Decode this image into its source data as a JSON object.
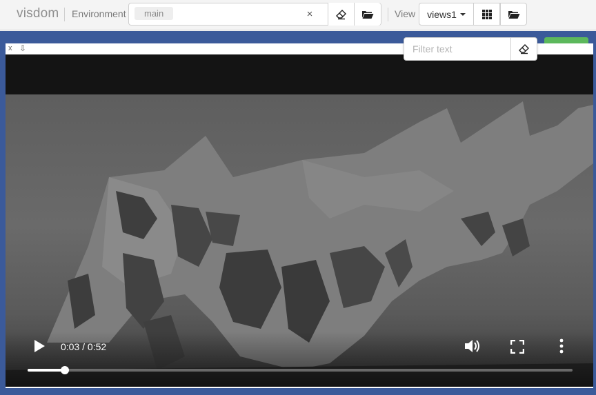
{
  "navbar": {
    "brand": "visdom",
    "environment_label": "Environment",
    "environment_selected": "main",
    "clear_symbol": "×",
    "view_label": "View",
    "views_selected": "views1"
  },
  "icons": {
    "eraser": "eraser-icon",
    "folder": "folder-open-icon",
    "grid": "grid-icon",
    "close": "close-icon"
  },
  "filter": {
    "placeholder": "Filter text"
  },
  "pane": {
    "close_symbol": "x",
    "download_symbol": "⇩"
  },
  "video": {
    "current_time": "0:03",
    "duration": "0:52",
    "time_display": "0:03 / 0:52",
    "progress_fraction": 0.068
  },
  "colors": {
    "workspace": "#3b5a9a",
    "accent_green": "#5cb85c"
  }
}
